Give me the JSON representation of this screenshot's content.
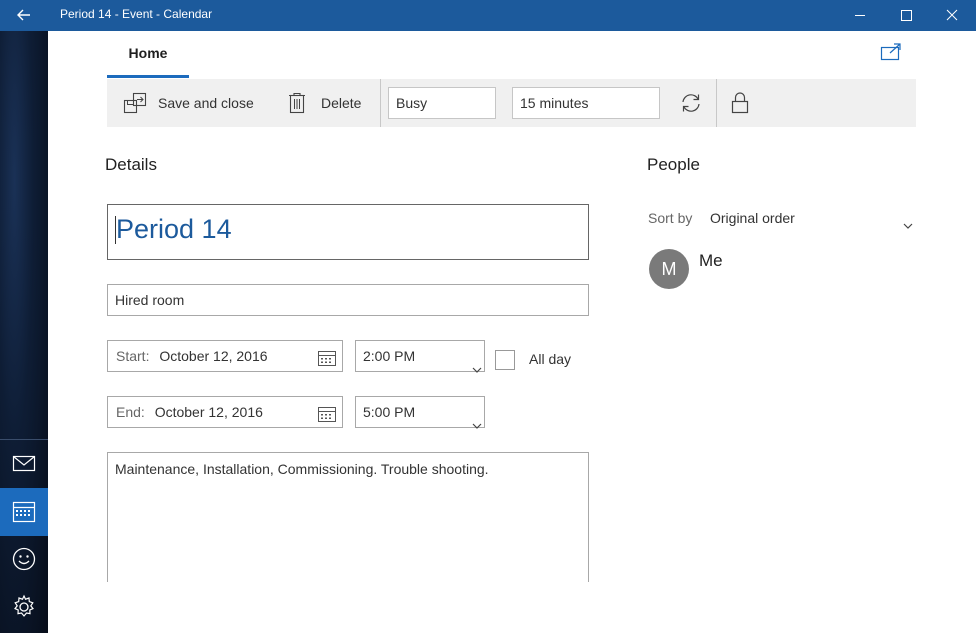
{
  "window": {
    "title": "Period 14 - Event - Calendar"
  },
  "tabs": {
    "home": "Home"
  },
  "toolbar": {
    "save_close_label": "Save and close",
    "delete_label": "Delete",
    "show_as": "Busy",
    "reminder": "15 minutes"
  },
  "details": {
    "heading": "Details",
    "event_title": "Period 14",
    "location": "Hired room",
    "start_label": "Start:",
    "start_date": "October 12, 2016",
    "start_time": "2:00 PM",
    "all_day_label": "All day",
    "end_label": "End:",
    "end_date": "October 12, 2016",
    "end_time": "5:00 PM",
    "notes": "Maintenance, Installation, Commissioning. Trouble shooting."
  },
  "people": {
    "heading": "People",
    "sort_by_label": "Sort by",
    "sort_by_value": "Original order",
    "attendees": [
      {
        "initial": "M",
        "name": "Me"
      }
    ]
  },
  "colors": {
    "titlebar": "#1c5a9c",
    "accent": "#1c6bbd"
  }
}
